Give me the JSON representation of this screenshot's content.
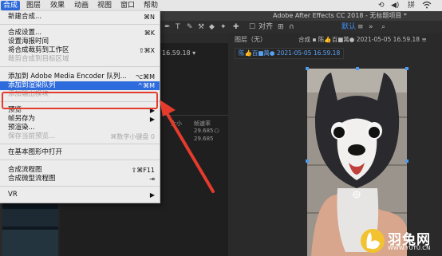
{
  "menubar": {
    "items": [
      "合成",
      "图层",
      "效果",
      "动画",
      "视图",
      "窗口",
      "帮助"
    ],
    "active_index": 0,
    "right_icons": [
      "sync-icon",
      "volume-icon",
      "language-indicator",
      "wifi-icon"
    ],
    "language": "拼"
  },
  "app_title": "Adobe After Effects CC 2018 - 无标题项目 *",
  "menu": {
    "items": [
      {
        "label": "新建合成...",
        "shortcut": "⌘N",
        "disabled": false,
        "highlighted": false
      },
      {
        "label": "合成设置...",
        "shortcut": "⌘K",
        "disabled": false,
        "highlighted": false
      },
      {
        "label": "设置海报时间",
        "shortcut": "",
        "disabled": false,
        "highlighted": false
      },
      {
        "label": "将合成裁剪到工作区",
        "shortcut": "⇧⌘X",
        "disabled": false,
        "highlighted": false
      },
      {
        "label": "裁剪合成到目标区域",
        "shortcut": "",
        "disabled": true,
        "highlighted": false
      },
      {
        "label": "添加到 Adobe Media Encoder 队列...",
        "shortcut": "⌥⌘M",
        "disabled": false,
        "highlighted": false
      },
      {
        "label": "添加到渲染队列",
        "shortcut": "^⌘M",
        "disabled": false,
        "highlighted": true
      },
      {
        "label": "添加输出模块",
        "shortcut": "",
        "disabled": true,
        "highlighted": false
      },
      {
        "label": "预览",
        "shortcut": "▶",
        "disabled": false,
        "highlighted": false
      },
      {
        "label": "帧另存为",
        "shortcut": "▶",
        "disabled": false,
        "highlighted": false
      },
      {
        "label": "预渲染...",
        "shortcut": "",
        "disabled": false,
        "highlighted": false
      },
      {
        "label": "保存当前预览...",
        "shortcut": "⌘数字小键盘 0",
        "disabled": true,
        "highlighted": false
      },
      {
        "label": "在基本图形中打开",
        "shortcut": "",
        "disabled": false,
        "highlighted": false
      },
      {
        "label": "合成流程图",
        "shortcut": "⇧⌘F11",
        "disabled": false,
        "highlighted": false
      },
      {
        "label": "合成微型流程图",
        "shortcut": "⇥",
        "disabled": false,
        "highlighted": false
      },
      {
        "label": "VR",
        "shortcut": "▶",
        "disabled": false,
        "highlighted": false
      }
    ]
  },
  "toolbar": {
    "snap_label": "对齐",
    "default_label": "默认"
  },
  "project": {
    "date_label": "16.59.18 ▾",
    "col_size": "大小",
    "col_fps": "帧速率",
    "fps1": "29.685",
    "fps2": "29.685"
  },
  "viewer": {
    "layer_header": "图层（无）",
    "comp_header": "合成 ▪ 陈👍百■萬● 2021-05-05 16.59.18 ≡",
    "tab_label": "陈👍百■萬● 2021-05-05 16.59.18"
  },
  "watermark": {
    "brand": "羽兔网",
    "url": "WWW.YUTU.CN"
  },
  "colors": {
    "highlight": "#2e6bdc",
    "annotation": "#e43b2c",
    "menu_bg": "#ececec"
  }
}
